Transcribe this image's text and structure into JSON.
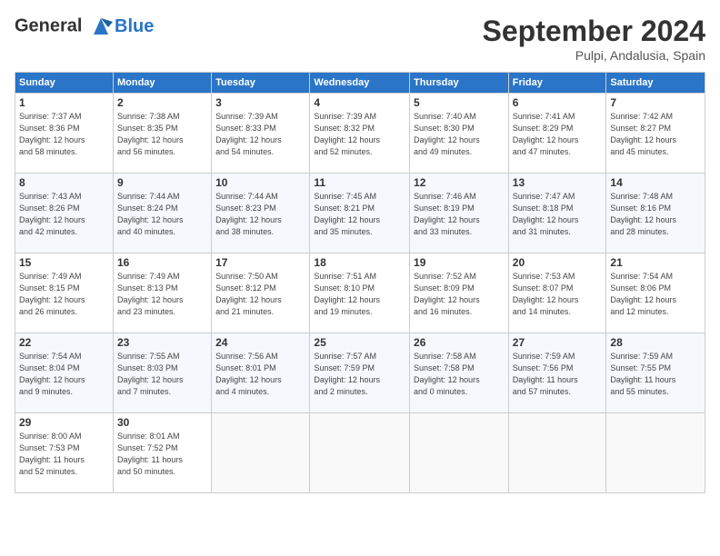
{
  "logo": {
    "line1": "General",
    "line2": "Blue"
  },
  "title": "September 2024",
  "subtitle": "Pulpi, Andalusia, Spain",
  "days_of_week": [
    "Sunday",
    "Monday",
    "Tuesday",
    "Wednesday",
    "Thursday",
    "Friday",
    "Saturday"
  ],
  "weeks": [
    [
      {
        "day": "1",
        "info": "Sunrise: 7:37 AM\nSunset: 8:36 PM\nDaylight: 12 hours\nand 58 minutes."
      },
      {
        "day": "2",
        "info": "Sunrise: 7:38 AM\nSunset: 8:35 PM\nDaylight: 12 hours\nand 56 minutes."
      },
      {
        "day": "3",
        "info": "Sunrise: 7:39 AM\nSunset: 8:33 PM\nDaylight: 12 hours\nand 54 minutes."
      },
      {
        "day": "4",
        "info": "Sunrise: 7:39 AM\nSunset: 8:32 PM\nDaylight: 12 hours\nand 52 minutes."
      },
      {
        "day": "5",
        "info": "Sunrise: 7:40 AM\nSunset: 8:30 PM\nDaylight: 12 hours\nand 49 minutes."
      },
      {
        "day": "6",
        "info": "Sunrise: 7:41 AM\nSunset: 8:29 PM\nDaylight: 12 hours\nand 47 minutes."
      },
      {
        "day": "7",
        "info": "Sunrise: 7:42 AM\nSunset: 8:27 PM\nDaylight: 12 hours\nand 45 minutes."
      }
    ],
    [
      {
        "day": "8",
        "info": "Sunrise: 7:43 AM\nSunset: 8:26 PM\nDaylight: 12 hours\nand 42 minutes."
      },
      {
        "day": "9",
        "info": "Sunrise: 7:44 AM\nSunset: 8:24 PM\nDaylight: 12 hours\nand 40 minutes."
      },
      {
        "day": "10",
        "info": "Sunrise: 7:44 AM\nSunset: 8:23 PM\nDaylight: 12 hours\nand 38 minutes."
      },
      {
        "day": "11",
        "info": "Sunrise: 7:45 AM\nSunset: 8:21 PM\nDaylight: 12 hours\nand 35 minutes."
      },
      {
        "day": "12",
        "info": "Sunrise: 7:46 AM\nSunset: 8:19 PM\nDaylight: 12 hours\nand 33 minutes."
      },
      {
        "day": "13",
        "info": "Sunrise: 7:47 AM\nSunset: 8:18 PM\nDaylight: 12 hours\nand 31 minutes."
      },
      {
        "day": "14",
        "info": "Sunrise: 7:48 AM\nSunset: 8:16 PM\nDaylight: 12 hours\nand 28 minutes."
      }
    ],
    [
      {
        "day": "15",
        "info": "Sunrise: 7:49 AM\nSunset: 8:15 PM\nDaylight: 12 hours\nand 26 minutes."
      },
      {
        "day": "16",
        "info": "Sunrise: 7:49 AM\nSunset: 8:13 PM\nDaylight: 12 hours\nand 23 minutes."
      },
      {
        "day": "17",
        "info": "Sunrise: 7:50 AM\nSunset: 8:12 PM\nDaylight: 12 hours\nand 21 minutes."
      },
      {
        "day": "18",
        "info": "Sunrise: 7:51 AM\nSunset: 8:10 PM\nDaylight: 12 hours\nand 19 minutes."
      },
      {
        "day": "19",
        "info": "Sunrise: 7:52 AM\nSunset: 8:09 PM\nDaylight: 12 hours\nand 16 minutes."
      },
      {
        "day": "20",
        "info": "Sunrise: 7:53 AM\nSunset: 8:07 PM\nDaylight: 12 hours\nand 14 minutes."
      },
      {
        "day": "21",
        "info": "Sunrise: 7:54 AM\nSunset: 8:06 PM\nDaylight: 12 hours\nand 12 minutes."
      }
    ],
    [
      {
        "day": "22",
        "info": "Sunrise: 7:54 AM\nSunset: 8:04 PM\nDaylight: 12 hours\nand 9 minutes."
      },
      {
        "day": "23",
        "info": "Sunrise: 7:55 AM\nSunset: 8:03 PM\nDaylight: 12 hours\nand 7 minutes."
      },
      {
        "day": "24",
        "info": "Sunrise: 7:56 AM\nSunset: 8:01 PM\nDaylight: 12 hours\nand 4 minutes."
      },
      {
        "day": "25",
        "info": "Sunrise: 7:57 AM\nSunset: 7:59 PM\nDaylight: 12 hours\nand 2 minutes."
      },
      {
        "day": "26",
        "info": "Sunrise: 7:58 AM\nSunset: 7:58 PM\nDaylight: 12 hours\nand 0 minutes."
      },
      {
        "day": "27",
        "info": "Sunrise: 7:59 AM\nSunset: 7:56 PM\nDaylight: 11 hours\nand 57 minutes."
      },
      {
        "day": "28",
        "info": "Sunrise: 7:59 AM\nSunset: 7:55 PM\nDaylight: 11 hours\nand 55 minutes."
      }
    ],
    [
      {
        "day": "29",
        "info": "Sunrise: 8:00 AM\nSunset: 7:53 PM\nDaylight: 11 hours\nand 52 minutes."
      },
      {
        "day": "30",
        "info": "Sunrise: 8:01 AM\nSunset: 7:52 PM\nDaylight: 11 hours\nand 50 minutes."
      },
      null,
      null,
      null,
      null,
      null
    ]
  ]
}
